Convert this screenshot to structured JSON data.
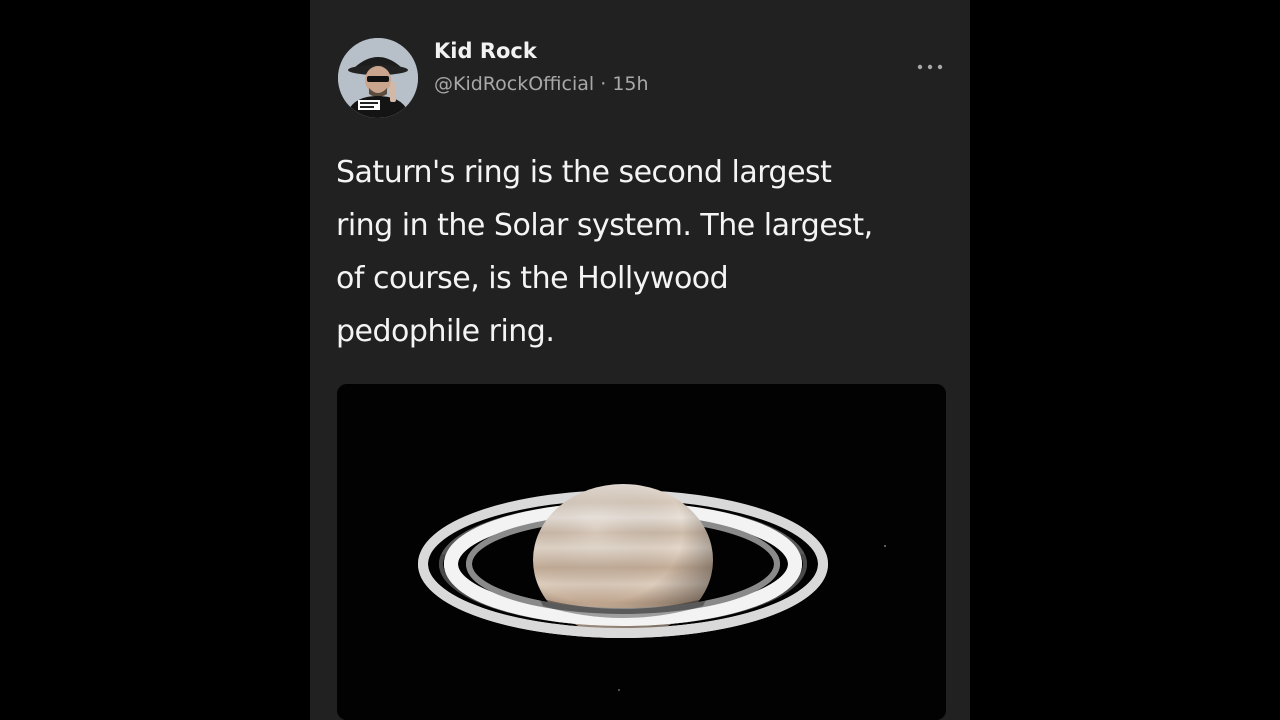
{
  "tweet": {
    "author_name": "Kid Rock",
    "handle": "@KidRockOfficial",
    "separator": "·",
    "time_ago": "15h",
    "text": "Saturn's ring is the second largest\nring in the Solar system. The largest,\nof course, is the Hollywood\npedophile ring.",
    "more_icon": "more-horizontal-icon",
    "avatar_icon": "user-avatar-photo",
    "media_subject": "saturn-photo"
  },
  "colors": {
    "page_background": "#000000",
    "card_background": "#212121",
    "primary_text": "#f4f4f4",
    "secondary_text": "#a8a8a8",
    "media_background": "#020202"
  }
}
